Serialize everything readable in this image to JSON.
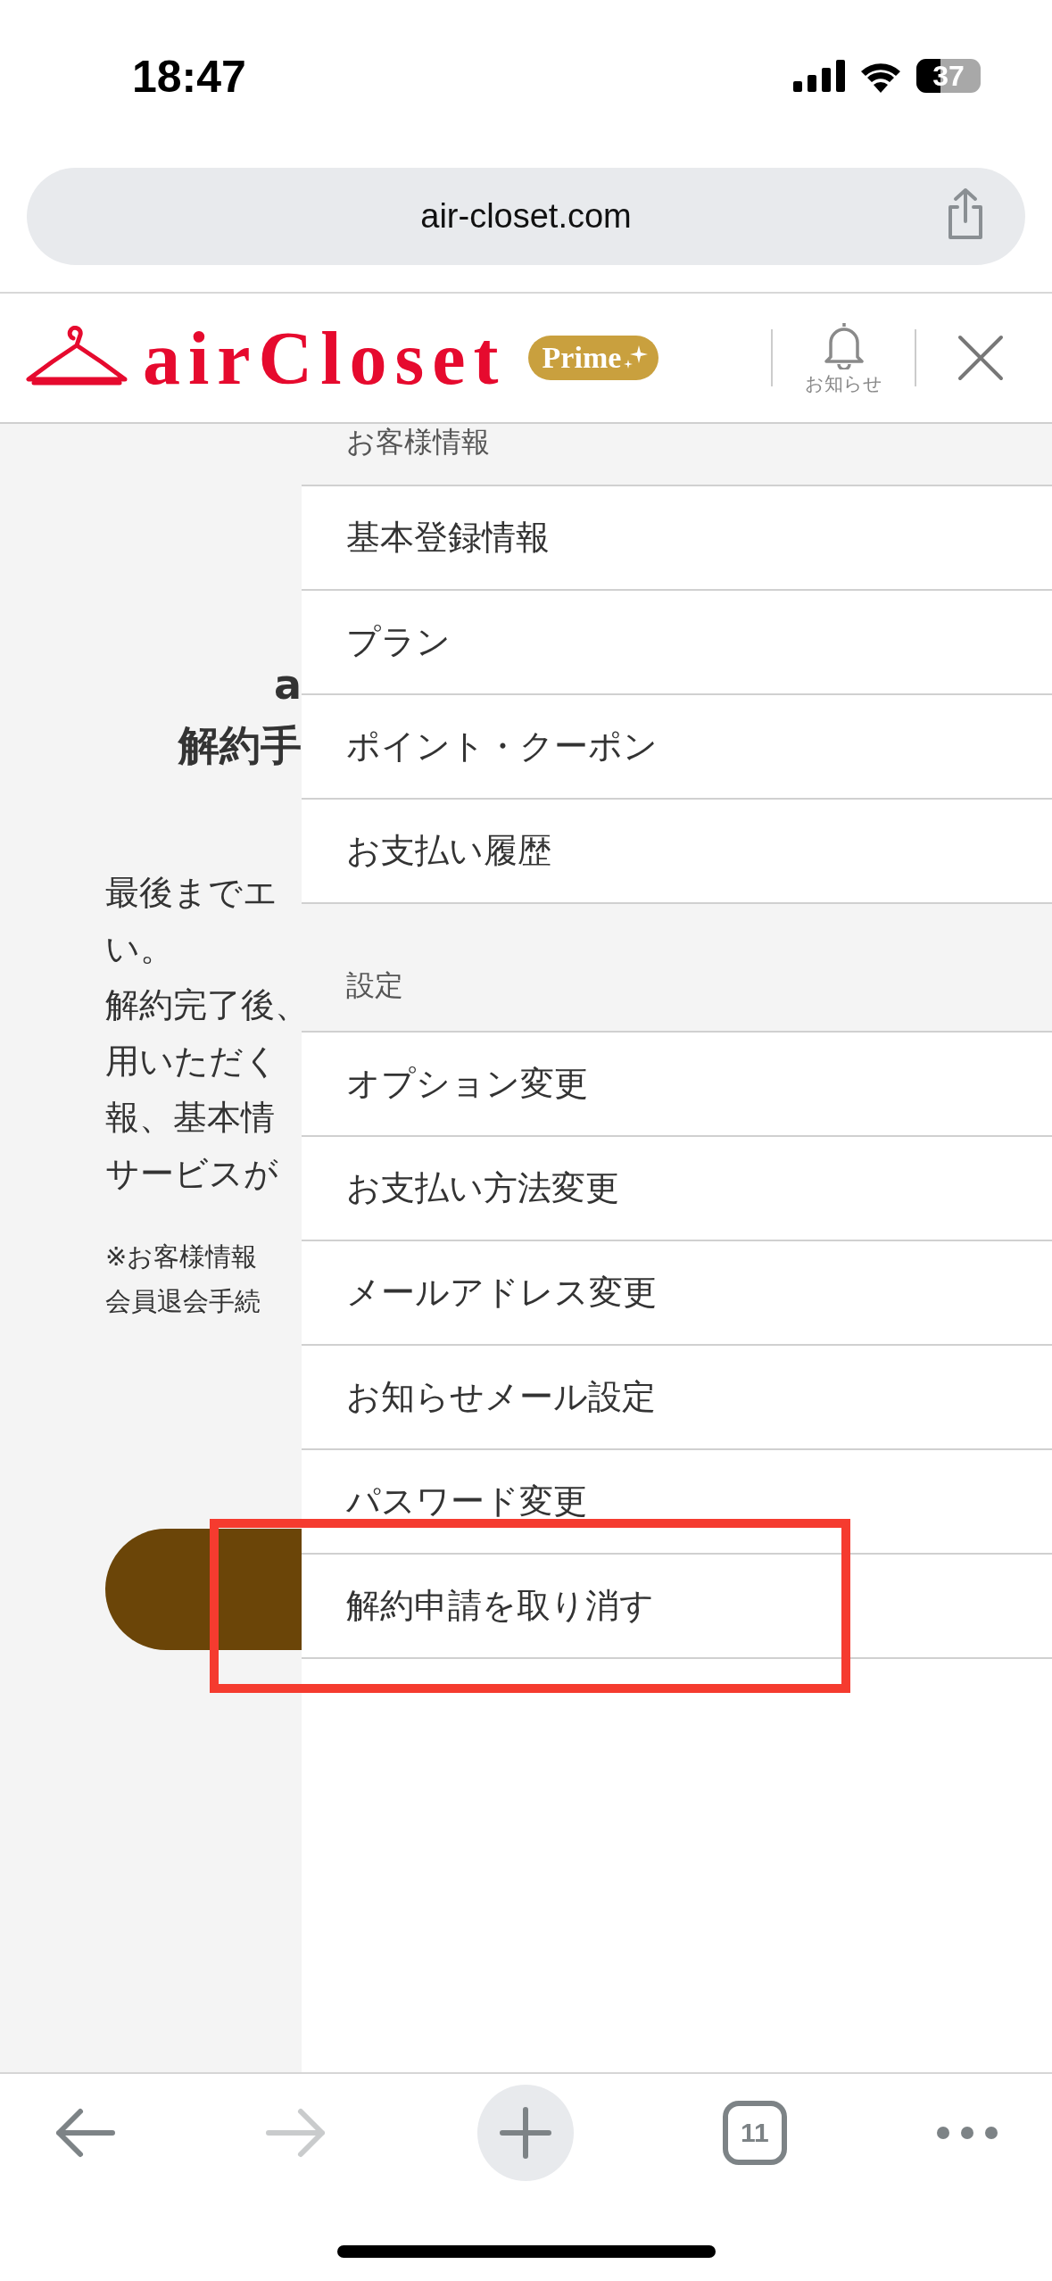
{
  "status_bar": {
    "time": "18:47",
    "battery": "37"
  },
  "address_bar": {
    "url": "air-closet.com"
  },
  "header": {
    "logo": "airCloset",
    "badge": "Prime",
    "notifications_label": "お知らせ"
  },
  "page": {
    "heading_lines": [
      "a",
      "解約手"
    ],
    "paragraph_lines": [
      "最後までエ",
      "い。",
      "解約完了後、",
      "用いただく",
      "報、基本情",
      "サービスが"
    ],
    "note_lines": [
      "※お客様情報",
      "会員退会手続"
    ]
  },
  "menu": {
    "sections": [
      {
        "title": "お客様情報",
        "items": [
          {
            "label": "基本登録情報",
            "annotated": false
          },
          {
            "label": "プラン",
            "annotated": false
          },
          {
            "label": "ポイント・クーポン",
            "annotated": false
          },
          {
            "label": "お支払い履歴",
            "annotated": false
          }
        ]
      },
      {
        "title": "設定",
        "items": [
          {
            "label": "オプション変更",
            "annotated": false
          },
          {
            "label": "お支払い方法変更",
            "annotated": false
          },
          {
            "label": "メールアドレス変更",
            "annotated": false
          },
          {
            "label": "お知らせメール設定",
            "annotated": false
          },
          {
            "label": "パスワード変更",
            "annotated": false
          },
          {
            "label": "解約申請を取り消す",
            "annotated": true
          }
        ]
      }
    ]
  },
  "toolbar": {
    "forward_disabled": true,
    "tabs_count": "11"
  }
}
